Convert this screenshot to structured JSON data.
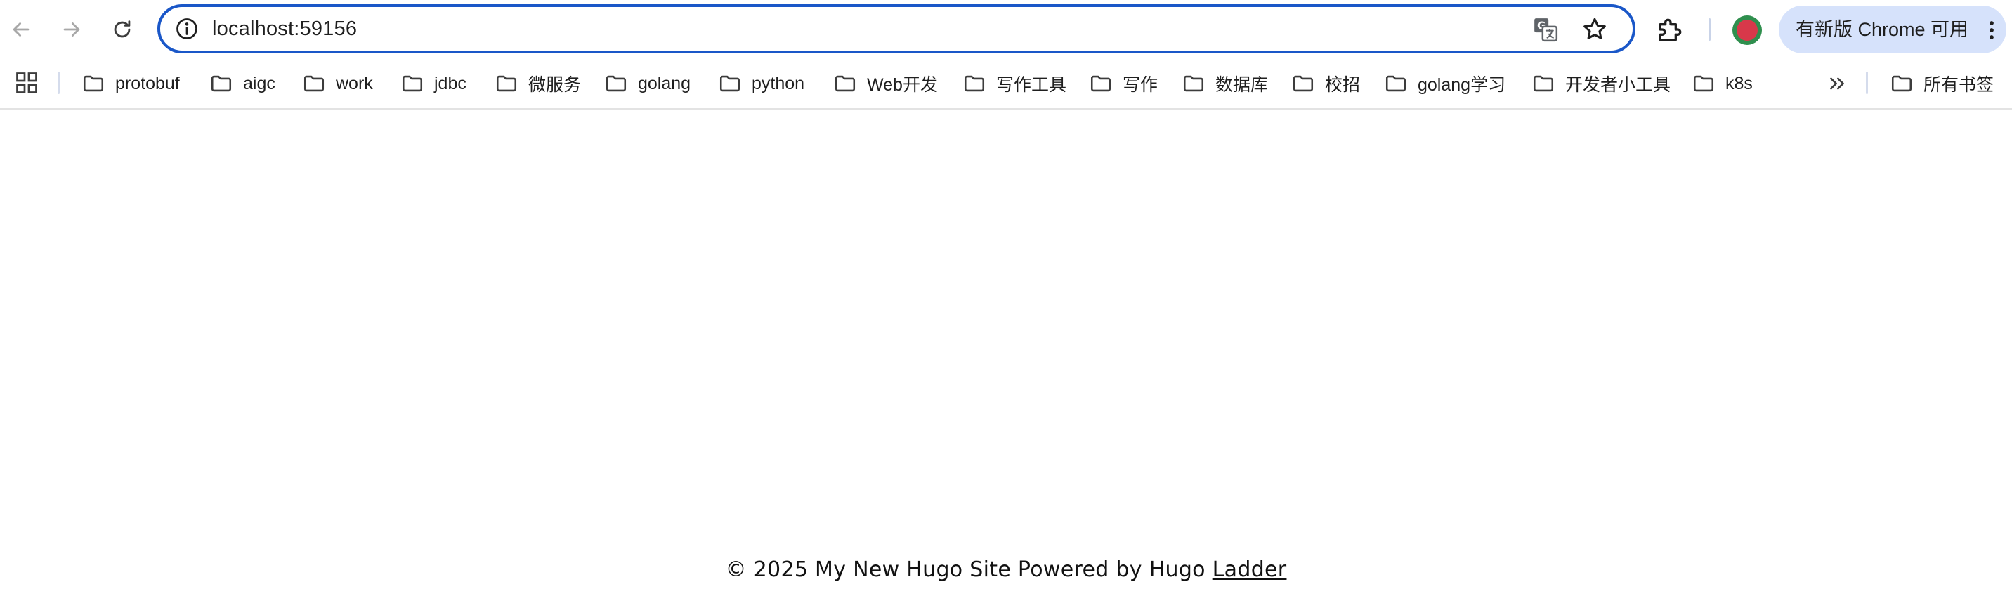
{
  "toolbar": {
    "url": "localhost:59156",
    "update_label": "有新版 Chrome 可用",
    "icons": {
      "back": "arrow-left-icon",
      "forward": "arrow-right-icon",
      "reload": "reload-icon",
      "site_info": "info-icon",
      "translate": "translate-icon",
      "bookmark": "star-icon",
      "extensions": "puzzle-icon",
      "menu": "kebab-icon"
    },
    "colors": {
      "omnibox_border": "#1a57c8",
      "update_pill": "#d6e2fb"
    }
  },
  "bookmarks": {
    "items": [
      {
        "label": "protobuf"
      },
      {
        "label": "aigc"
      },
      {
        "label": "work"
      },
      {
        "label": "jdbc"
      },
      {
        "label": "微服务"
      },
      {
        "label": "golang"
      },
      {
        "label": "python"
      },
      {
        "label": "Web开发"
      },
      {
        "label": "写作工具"
      },
      {
        "label": "写作"
      },
      {
        "label": "数据库"
      },
      {
        "label": "校招"
      },
      {
        "label": "golang学习"
      },
      {
        "label": "开发者小工具"
      },
      {
        "label": "k8s"
      }
    ],
    "all_bookmarks_label": "所有书签"
  },
  "footer": {
    "text": "© 2025 My New Hugo Site Powered by Hugo",
    "link_label": "Ladder"
  }
}
